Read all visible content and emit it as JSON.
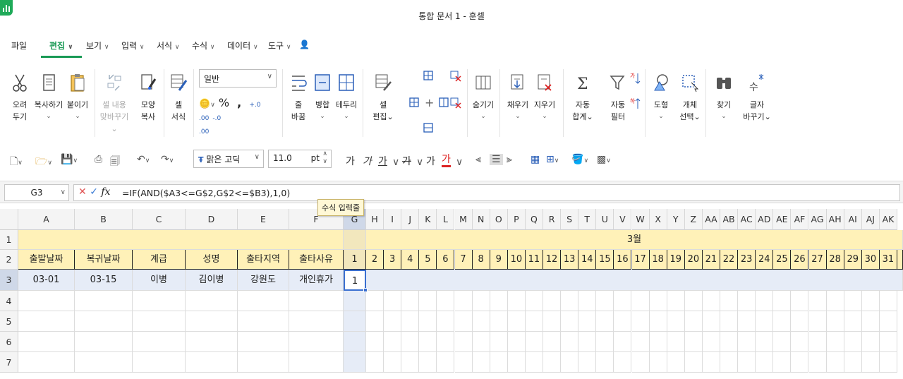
{
  "window": {
    "title": "통합 문서 1 - 훈셀"
  },
  "menus": [
    {
      "label": "파일",
      "has_caret": false
    },
    {
      "label": "편집",
      "has_caret": true,
      "active": true
    },
    {
      "label": "보기",
      "has_caret": true
    },
    {
      "label": "입력",
      "has_caret": true
    },
    {
      "label": "서식",
      "has_caret": true
    },
    {
      "label": "수식",
      "has_caret": true
    },
    {
      "label": "데이터",
      "has_caret": true
    },
    {
      "label": "도구",
      "has_caret": true
    }
  ],
  "ribbon": {
    "cut": {
      "line1": "오려",
      "line2": "두기"
    },
    "copy": {
      "line1": "복사하기",
      "line2": "⌄"
    },
    "paste": {
      "line1": "붙이기",
      "line2": "⌄"
    },
    "paste_special": {
      "line1": "셀 내용",
      "line2": "맞바꾸기⌄"
    },
    "format_painter": {
      "line1": "모양",
      "line2": "복사"
    },
    "cell_format": {
      "line1": "셀",
      "line2": "서식"
    },
    "number_format_value": "일반",
    "percent": "%",
    "comma": ",",
    "wrap": {
      "line1": "줄",
      "line2": "바꿈"
    },
    "merge": {
      "line1": "병합",
      "line2": "⌄"
    },
    "borders": {
      "line1": "테두리",
      "line2": "⌄"
    },
    "cell_edit": {
      "line1": "셀",
      "line2": "편집⌄"
    },
    "hide": {
      "line1": "숨기기",
      "line2": "⌄"
    },
    "fill": {
      "line1": "채우기",
      "line2": "⌄"
    },
    "clear": {
      "line1": "지우기",
      "line2": "⌄"
    },
    "autosum": {
      "line1": "자동",
      "line2": "합계⌄"
    },
    "autofilter": {
      "line1": "자동",
      "line2": "필터"
    },
    "shapes": {
      "line1": "도형",
      "line2": "⌄"
    },
    "select_objects": {
      "line1": "개체",
      "line2": "선택⌄"
    },
    "find": {
      "line1": "찾기",
      "line2": "⌄"
    },
    "replace": {
      "line1": "글자",
      "line2": "바꾸기⌄"
    }
  },
  "quickbar": {
    "font_name": "맑은 고딕",
    "font_size": "11.0",
    "font_unit": "pt",
    "bold": "가",
    "italic": "가",
    "underline": "가",
    "strike": "가",
    "superscript": "가",
    "font_color": "가"
  },
  "formula_bar": {
    "cell_ref": "G3",
    "fx": "fx",
    "formula": "=IF(AND($A3<=G$2,G$2<=$B3),1,0)"
  },
  "tooltip": "수식 입력줄",
  "sheet": {
    "columns": [
      "A",
      "B",
      "C",
      "D",
      "E",
      "F",
      "G",
      "H",
      "I",
      "J",
      "K",
      "L",
      "M",
      "N",
      "O",
      "P",
      "Q",
      "R",
      "S",
      "T",
      "U",
      "V",
      "W",
      "X",
      "Y",
      "Z",
      "AA",
      "AB",
      "AC",
      "AD",
      "AE",
      "AF",
      "AG",
      "AH",
      "AI",
      "AJ",
      "AK"
    ],
    "rows": [
      "1",
      "2",
      "3",
      "4",
      "5",
      "6",
      "7"
    ],
    "month_label": "3월",
    "header_row": [
      "출발날짜",
      "복귀날짜",
      "계급",
      "성명",
      "출타지역",
      "출타사유"
    ],
    "days": [
      "1",
      "2",
      "3",
      "4",
      "5",
      "6",
      "7",
      "8",
      "9",
      "10",
      "11",
      "12",
      "13",
      "14",
      "15",
      "16",
      "17",
      "18",
      "19",
      "20",
      "21",
      "22",
      "23",
      "24",
      "25",
      "26",
      "27",
      "28",
      "29",
      "30",
      "31"
    ],
    "row3": [
      "03-01",
      "03-15",
      "이병",
      "김이병",
      "강원도",
      "개인휴가"
    ],
    "active_value": "1",
    "colors": {
      "header_fill": "#fff1b8",
      "selection": "#e6ecf7",
      "accent": "#1a9a55"
    }
  }
}
